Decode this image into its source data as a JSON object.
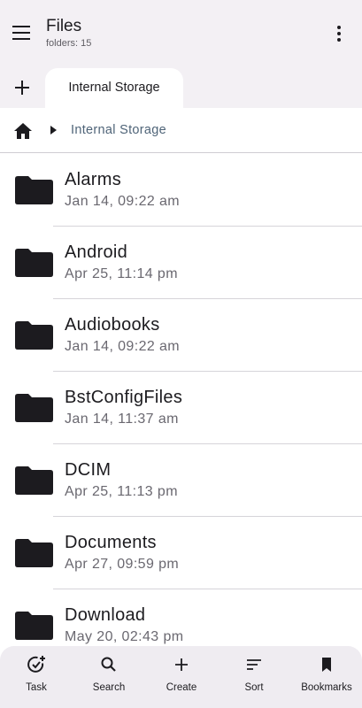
{
  "header": {
    "title": "Files",
    "subtitle": "folders: 15",
    "menu_icon": "menu-icon",
    "more_icon": "more-vert-icon"
  },
  "tabs": {
    "add_icon": "add-icon",
    "items": [
      {
        "label": "Internal Storage",
        "selected": true
      }
    ]
  },
  "breadcrumb": {
    "home_icon": "home-icon",
    "separator_icon": "arrow-right-icon",
    "path": "Internal Storage"
  },
  "files": [
    {
      "name": "Alarms",
      "date": "Jan 14, 09:22 am"
    },
    {
      "name": "Android",
      "date": "Apr 25, 11:14 pm"
    },
    {
      "name": "Audiobooks",
      "date": "Jan 14, 09:22 am"
    },
    {
      "name": "BstConfigFiles",
      "date": "Jan 14, 11:37 am"
    },
    {
      "name": "DCIM",
      "date": "Apr 25, 11:13 pm"
    },
    {
      "name": "Documents",
      "date": "Apr 27, 09:59 pm"
    },
    {
      "name": "Download",
      "date": "May 20, 02:43 pm"
    }
  ],
  "bottom_nav": [
    {
      "label": "Task",
      "icon": "task-icon"
    },
    {
      "label": "Search",
      "icon": "search-icon"
    },
    {
      "label": "Create",
      "icon": "add-icon"
    },
    {
      "label": "Sort",
      "icon": "sort-icon"
    },
    {
      "label": "Bookmarks",
      "icon": "bookmark-icon"
    }
  ],
  "colors": {
    "appbar_bg": "#f3f0f4",
    "breadcrumb_text": "#4f6478",
    "folder": "#1c1b1f",
    "bottom_nav_bg": "#efecf1"
  }
}
